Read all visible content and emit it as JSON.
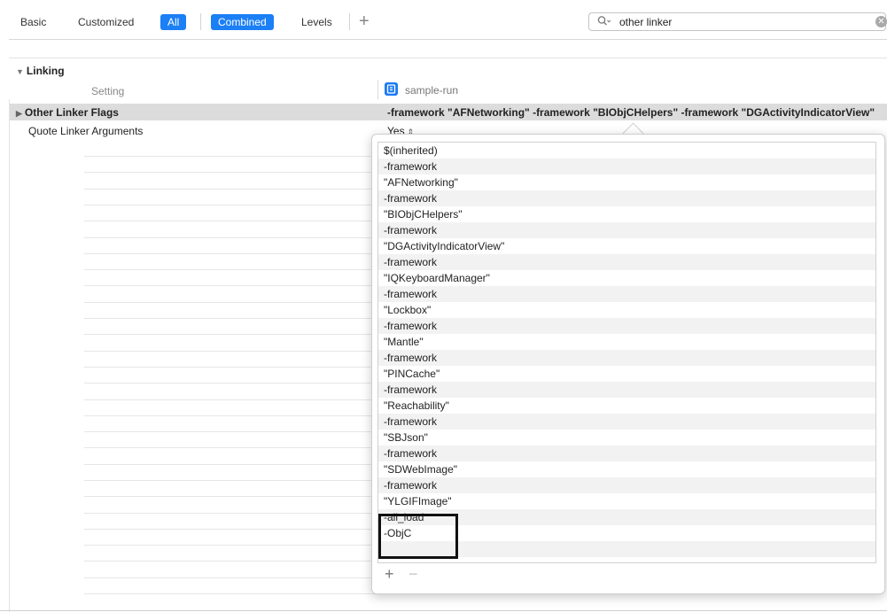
{
  "toolbar": {
    "tabs": [
      {
        "label": "Basic"
      },
      {
        "label": "Customized"
      },
      {
        "label": "All",
        "selected": true
      }
    ],
    "levels": [
      {
        "label": "Combined",
        "selected": true
      },
      {
        "label": "Levels"
      }
    ],
    "add_label": "+",
    "search": {
      "value": "other linker",
      "placeholder": "",
      "icon": "search-icon"
    }
  },
  "section": {
    "title": "Linking",
    "setting_header": "Setting",
    "target_name": "sample-run",
    "target_icon": "target-app-icon"
  },
  "rows": [
    {
      "name": "Other Linker Flags",
      "value": "-framework \"AFNetworking\" -framework \"BIObjCHelpers\" -framework \"DGActivityIndicatorView\"",
      "expanded": false,
      "bold": true
    },
    {
      "name": "Quote Linker Arguments",
      "value": "Yes",
      "bold": false
    }
  ],
  "popover": {
    "items": [
      "$(inherited)",
      "-framework",
      "\"AFNetworking\"",
      "-framework",
      "\"BIObjCHelpers\"",
      "-framework",
      "\"DGActivityIndicatorView\"",
      "-framework",
      "\"IQKeyboardManager\"",
      "-framework",
      "\"Lockbox\"",
      "-framework",
      "\"Mantle\"",
      "-framework",
      "\"PINCache\"",
      "-framework",
      "\"Reachability\"",
      "-framework",
      "\"SBJson\"",
      "-framework",
      "\"SDWebImage\"",
      "-framework",
      "\"YLGIFImage\"",
      "-all_load",
      "-ObjC",
      ""
    ],
    "add_label": "+",
    "remove_label": "−"
  },
  "colors": {
    "accent": "#1b7ff5",
    "row_highlight": "#dcdcdc",
    "annotation_box": "#111111"
  }
}
